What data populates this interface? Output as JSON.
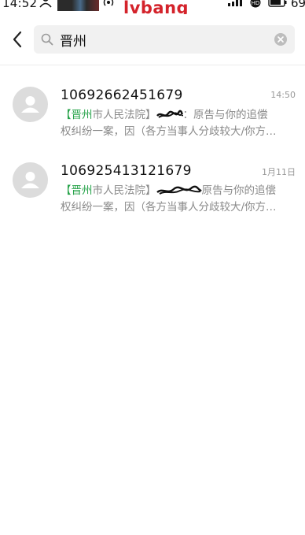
{
  "status_bar": {
    "time": "14:52",
    "watermark": "lvbang",
    "battery_level": "69",
    "icons": [
      "user-icon",
      "thumbnail",
      "hotspot-icon",
      "signal-icon",
      "hd-icon",
      "battery-icon"
    ]
  },
  "search": {
    "value": "晋州",
    "placeholder": ""
  },
  "colors": {
    "highlight": "#27a34a",
    "watermark": "#d4232b",
    "avatar_bg": "#dcdcdc",
    "secondary_text": "#8a8a8a"
  },
  "conversations": [
    {
      "number": "10692662451679",
      "time": "14:50",
      "preview": {
        "open_bracket": "【",
        "highlight": "晋州",
        "sender_rest": "市人民法院】",
        "after_redaction": "：原告与你的追偿",
        "line2": "权纠纷一案，因（各方当事人分歧较大/你方…"
      }
    },
    {
      "number": "106925413121679",
      "time": "1月11日",
      "preview": {
        "open_bracket": "【",
        "highlight": "晋州",
        "sender_rest": "市人民法院】",
        "after_redaction": "原告与你的追偿",
        "line2": "权纠纷一案，因（各方当事人分歧较大/你方…"
      }
    }
  ]
}
